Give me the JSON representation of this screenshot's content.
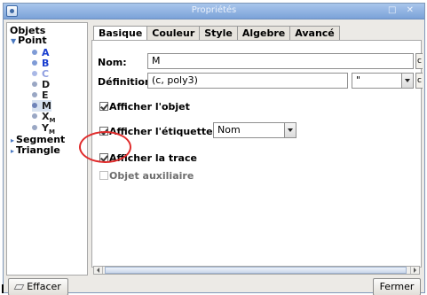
{
  "window": {
    "title": "Propriétés",
    "controls": "□ ✕"
  },
  "tree": {
    "header": "Objets",
    "groups": [
      {
        "label": "Point",
        "expanded": true
      },
      {
        "label": "Segment",
        "expanded": false
      },
      {
        "label": "Triangle",
        "expanded": false
      }
    ],
    "points": [
      {
        "name": "A",
        "color": "#1a3fcf",
        "dot": "#7f9bd6"
      },
      {
        "name": "B",
        "color": "#1a3fcf",
        "dot": "#7f9bd6"
      },
      {
        "name": "C",
        "color": "#8f9ee0",
        "dot": "#a9b8e6"
      },
      {
        "name": "D",
        "color": "#202020",
        "dot": "#9aa7c4"
      },
      {
        "name": "E",
        "color": "#202020",
        "dot": "#9aa7c4"
      },
      {
        "name": "M",
        "color": "#202020",
        "dot": "#6f83b8",
        "selected": true
      },
      {
        "name": "X",
        "sub": "M",
        "color": "#202020",
        "dot": "#9aa7c4"
      },
      {
        "name": "Y",
        "sub": "M",
        "color": "#202020",
        "dot": "#9aa7c4"
      }
    ]
  },
  "tabs": [
    "Basique",
    "Couleur",
    "Style",
    "Algebre",
    "Avancé"
  ],
  "active_tab": "Basique",
  "form": {
    "nom_label": "Nom:",
    "nom_value": "M",
    "definition_label": "Définition:",
    "definition_value": "(c, poly3)",
    "definition_combo_value": "\"",
    "edge_letter": "c"
  },
  "checks": {
    "show_object": {
      "label": "Afficher l'objet",
      "checked": true
    },
    "show_label": {
      "label": "Afficher l'étiquette:",
      "checked": true,
      "select_value": "Nom"
    },
    "show_trace": {
      "label": "Afficher la trace",
      "checked": true
    },
    "auxiliary": {
      "label": "Objet auxiliaire",
      "checked": false
    }
  },
  "buttons": {
    "delete": "Effacer",
    "close": "Fermer"
  },
  "colors": {
    "highlight_circle": "#e02b2b",
    "titlebar": "#7ba2d8"
  }
}
